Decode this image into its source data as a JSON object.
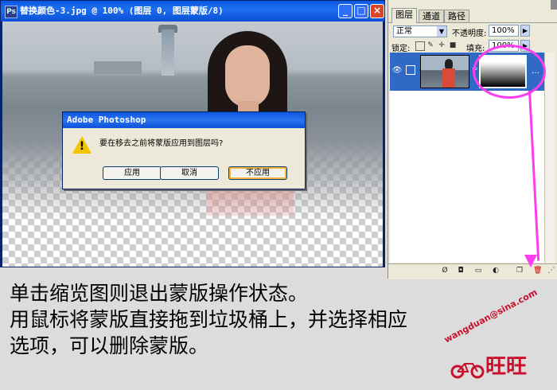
{
  "document_window": {
    "title": "替换颜色-3.jpg @ 100% (图层 0, 图层蒙版/8)",
    "minimize_label": "_",
    "maximize_label": "□",
    "close_label": "×"
  },
  "dialog": {
    "title": "Adobe Photoshop",
    "message": "要在移去之前将蒙版应用到图层吗?",
    "buttons": {
      "apply": "应用",
      "cancel": "取消",
      "dont_apply": "不应用"
    }
  },
  "layers_panel": {
    "tabs": [
      "图层",
      "通道",
      "路径"
    ],
    "blend_mode": "正常",
    "opacity_label": "不透明度:",
    "opacity_value": "100%",
    "lock_label": "锁定:",
    "fill_label": "填充:",
    "fill_value": "100%"
  },
  "caption": {
    "line1": "单击缩览图则退出蒙版操作状态。",
    "line2": "用鼠标将蒙版直接拖到垃圾桶上，并选择相应",
    "line3": "选项，可以删除蒙版。"
  },
  "watermark": {
    "text": "wangduan@sina.com",
    "name": "旺旺"
  },
  "colors": {
    "titlebar": "#0a58e0",
    "annotation": "#ff3df0",
    "selected_layer": "#3169c6"
  }
}
